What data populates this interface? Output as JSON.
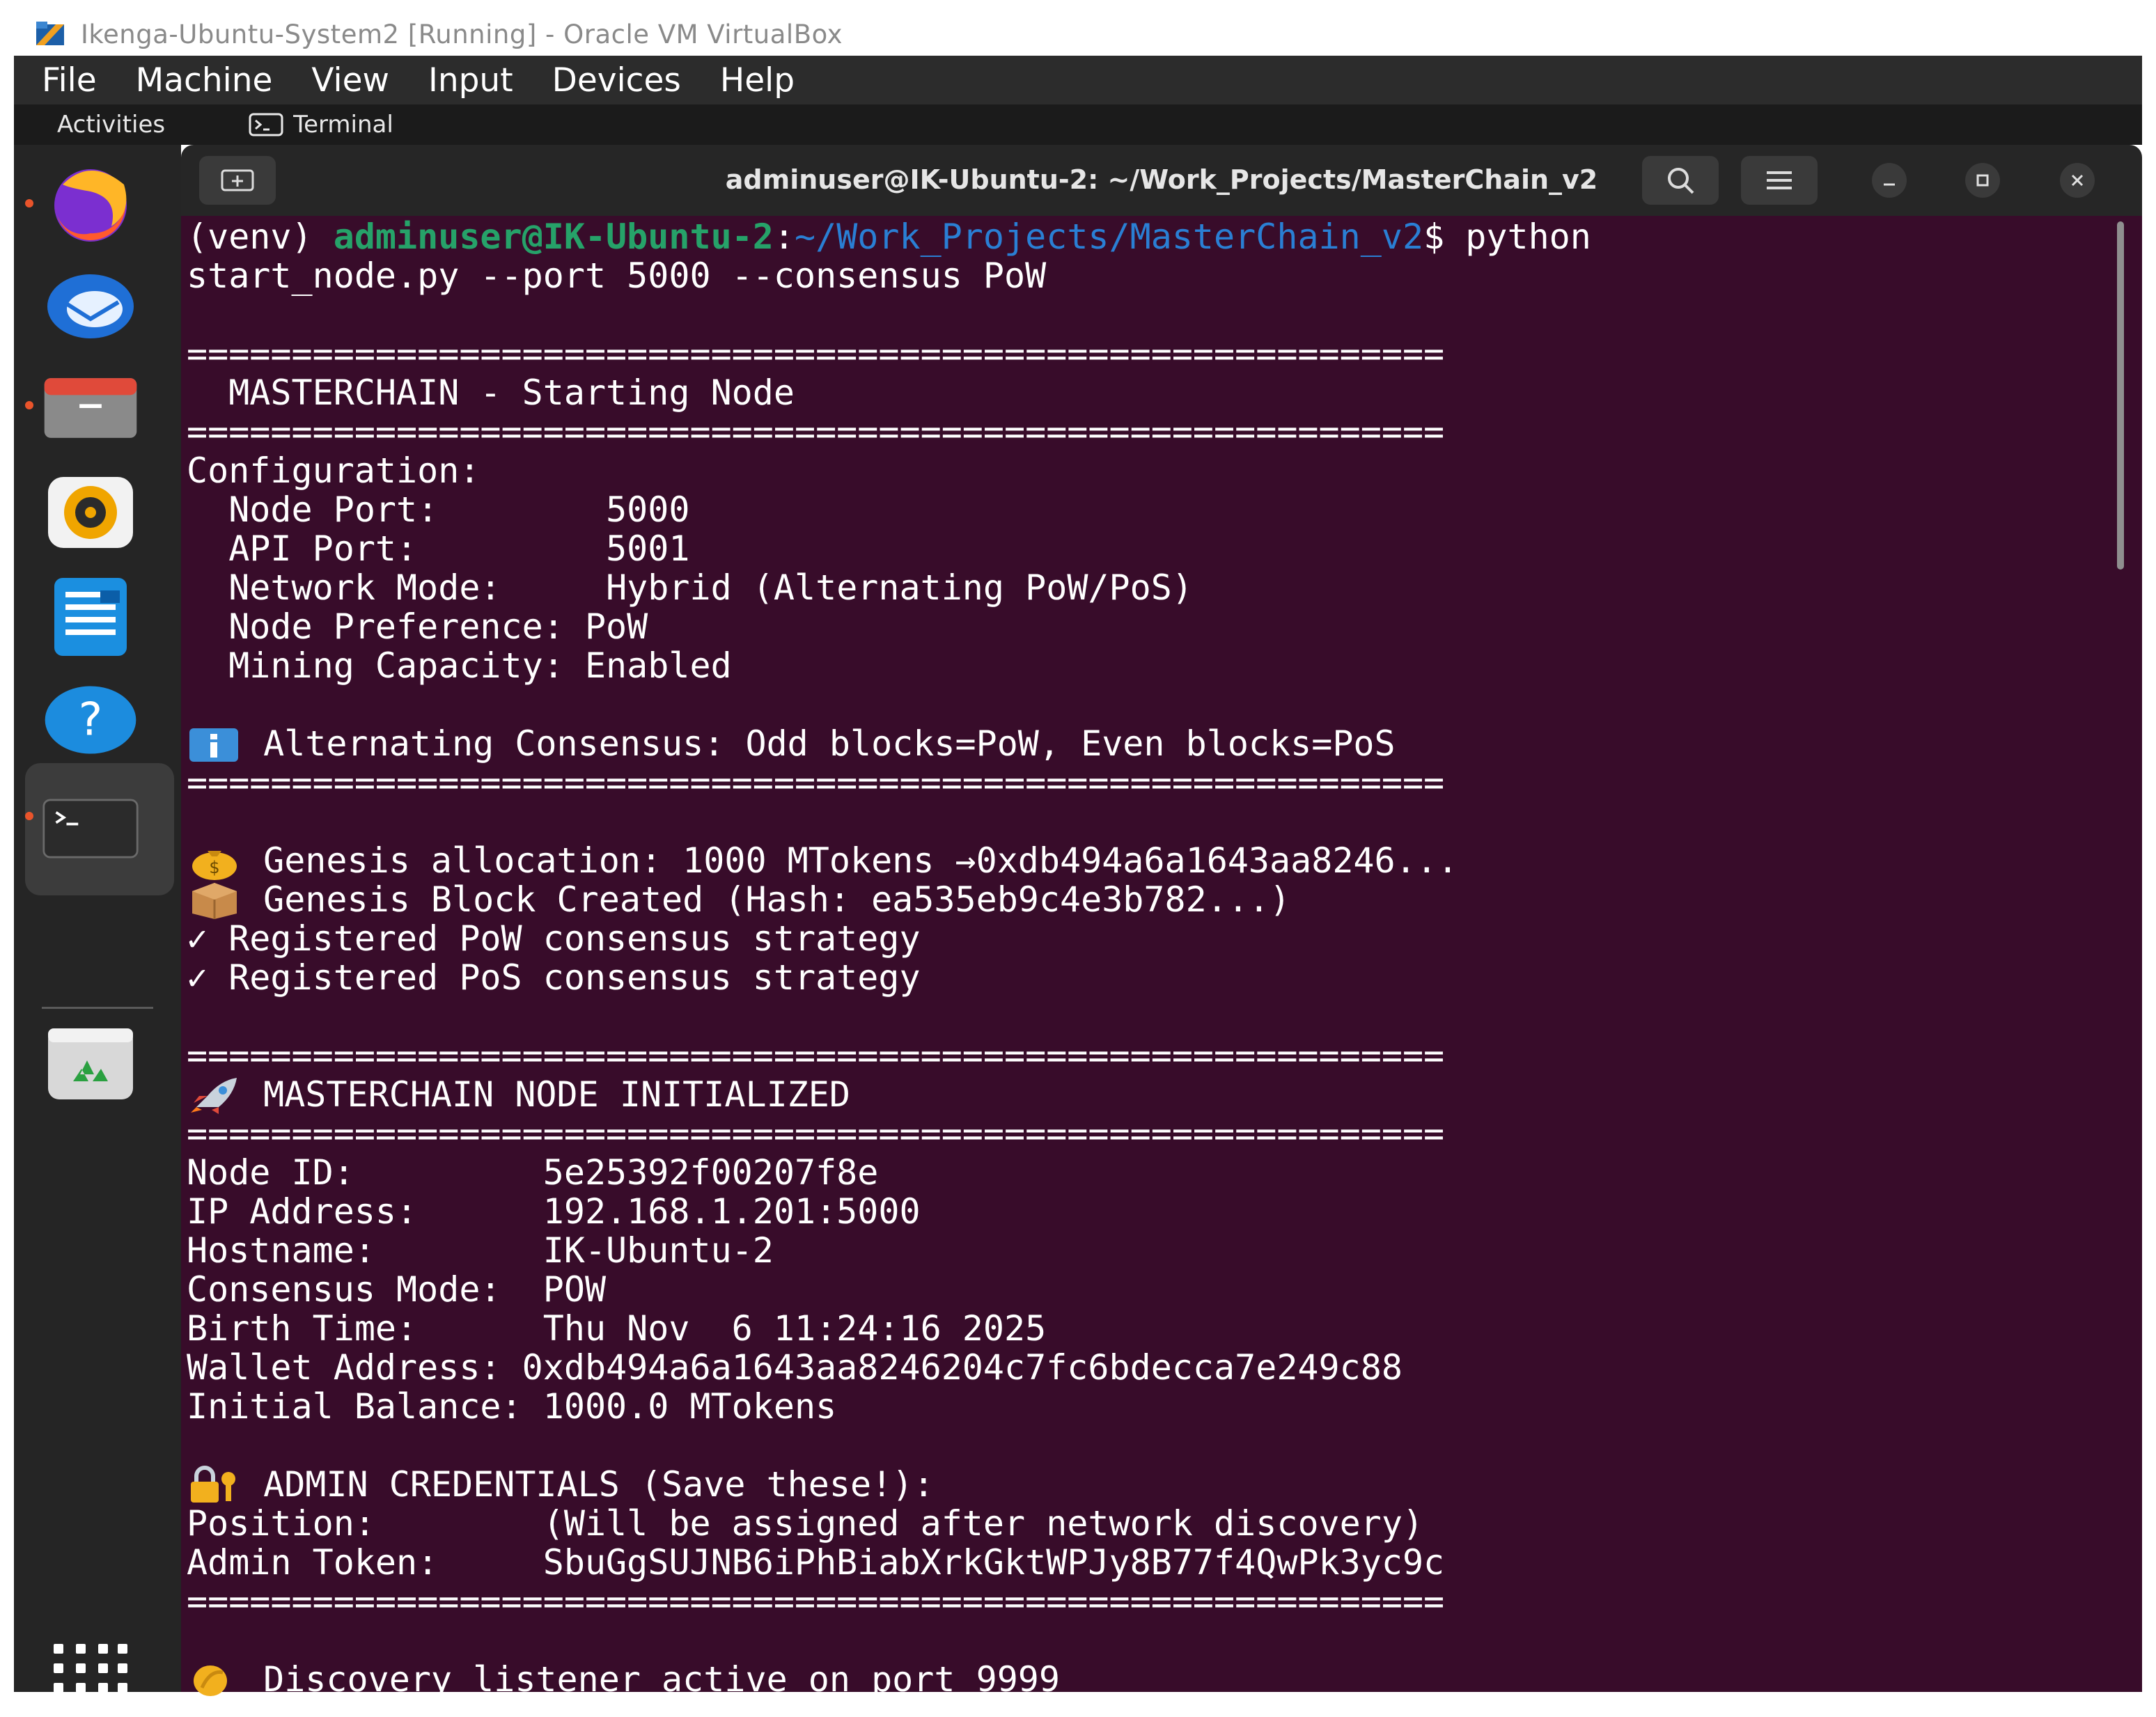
{
  "vbox": {
    "title": "Ikenga-Ubuntu-System2 [Running] - Oracle VM VirtualBox",
    "menu": [
      "File",
      "Machine",
      "View",
      "Input",
      "Devices",
      "Help"
    ]
  },
  "gnome": {
    "activities": "Activities",
    "app_name": "Terminal"
  },
  "dock": {
    "items": [
      "firefox-icon",
      "thunderbird-icon",
      "files-icon",
      "rhythmbox-icon",
      "writer-icon",
      "help-icon",
      "terminal-icon",
      "trash-icon",
      "app-grid-icon"
    ]
  },
  "terminal": {
    "title": "adminuser@IK-Ubuntu-2: ~/Work_Projects/MasterChain_v2",
    "prompt_venv": "(venv) ",
    "prompt_user": "adminuser@IK-Ubuntu-2",
    "prompt_colon": ":",
    "prompt_path": "~/Work_Projects/MasterChain_v2",
    "prompt_dollar": "$ python",
    "command_cont": "start_node.py --port 5000 --consensus PoW",
    "separator": "============================================================",
    "header_starting": "  MASTERCHAIN - Starting Node",
    "config_title": "Configuration:",
    "config": [
      {
        "label": "  Node Port:        ",
        "value": "5000"
      },
      {
        "label": "  API Port:         ",
        "value": "5001"
      },
      {
        "label": "  Network Mode:     ",
        "value": "Hybrid (Alternating PoW/PoS)"
      },
      {
        "label": "  Node Preference: ",
        "value": "PoW"
      },
      {
        "label": "  Mining Capacity: ",
        "value": "Enabled"
      }
    ],
    "alternating": " Alternating Consensus: Odd blocks=PoW, Even blocks=PoS",
    "genesis_alloc": " Genesis allocation: 1000 MTokens →0xdb494a6a1643aa8246...",
    "genesis_block": " Genesis Block Created (Hash: ea535eb9c4e3b782...)",
    "registered_pow": "✓ Registered PoW consensus strategy",
    "registered_pos": "✓ Registered PoS consensus strategy",
    "node_initialized": " MASTERCHAIN NODE INITIALIZED",
    "node_info": [
      {
        "label": "Node ID:         ",
        "value": "5e25392f00207f8e"
      },
      {
        "label": "IP Address:      ",
        "value": "192.168.1.201:5000"
      },
      {
        "label": "Hostname:        ",
        "value": "IK-Ubuntu-2"
      },
      {
        "label": "Consensus Mode:  ",
        "value": "POW"
      },
      {
        "label": "Birth Time:      ",
        "value": "Thu Nov  6 11:24:16 2025"
      },
      {
        "label": "Wallet Address: ",
        "value": "0xdb494a6a1643aa8246204c7fc6bdecca7e249c88"
      },
      {
        "label": "Initial Balance: ",
        "value": "1000.0 MTokens"
      }
    ],
    "admin_header": " ADMIN CREDENTIALS (Save these!):",
    "admin": [
      {
        "label": "Position:        ",
        "value": "(Will be assigned after network discovery)"
      },
      {
        "label": "Admin Token:     ",
        "value": "SbuGgSUJNB6iPhBiabXrkGktWPJy8B77f4QwPk3yc9c"
      }
    ],
    "discovery": " Discovery listener active on port 9999"
  },
  "colors": {
    "terminal_bg": "#380c2a",
    "prompt_user": "#26a269",
    "prompt_path": "#2a7fd4"
  }
}
